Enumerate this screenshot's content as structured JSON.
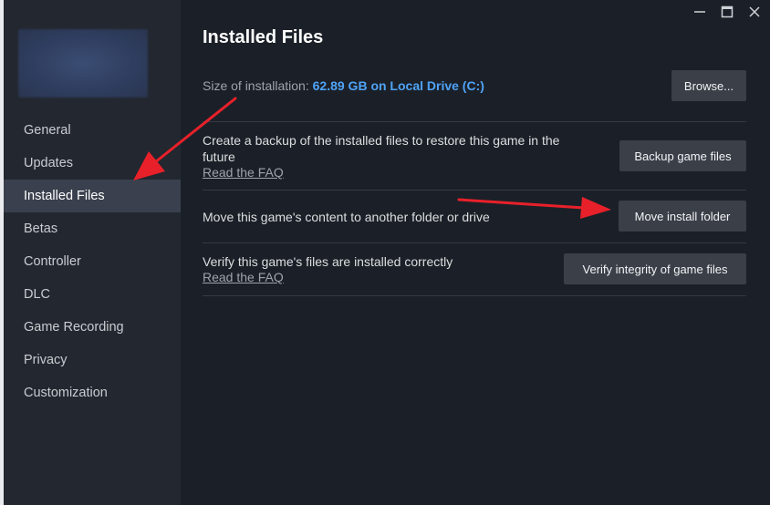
{
  "window": {
    "controls": {
      "minimize_icon": "minimize-icon",
      "maximize_icon": "maximize-icon",
      "close_icon": "close-icon"
    }
  },
  "sidebar": {
    "items": [
      {
        "label": "General",
        "active": false
      },
      {
        "label": "Updates",
        "active": false
      },
      {
        "label": "Installed Files",
        "active": true
      },
      {
        "label": "Betas",
        "active": false
      },
      {
        "label": "Controller",
        "active": false
      },
      {
        "label": "DLC",
        "active": false
      },
      {
        "label": "Game Recording",
        "active": false
      },
      {
        "label": "Privacy",
        "active": false
      },
      {
        "label": "Customization",
        "active": false
      }
    ]
  },
  "main": {
    "title": "Installed Files",
    "size_label": "Size of installation:",
    "size_value": "62.89 GB on Local Drive (C:)",
    "browse_label": "Browse...",
    "backup": {
      "text_line1": "Create a backup of the installed files to restore this game in the",
      "text_line2": "future",
      "faq": "Read the FAQ",
      "button": "Backup game files"
    },
    "move": {
      "text": "Move this game's content to another folder or drive",
      "button": "Move install folder"
    },
    "verify": {
      "text": "Verify this game's files are installed correctly",
      "faq": "Read the FAQ",
      "button": "Verify integrity of game files"
    }
  },
  "colors": {
    "accent_link": "#4fa3f7",
    "annotation_arrow": "#e8202a",
    "background": "#1b2028",
    "sidebar": "#23272f",
    "active_item": "#3a404d",
    "button": "#3a3f48"
  }
}
